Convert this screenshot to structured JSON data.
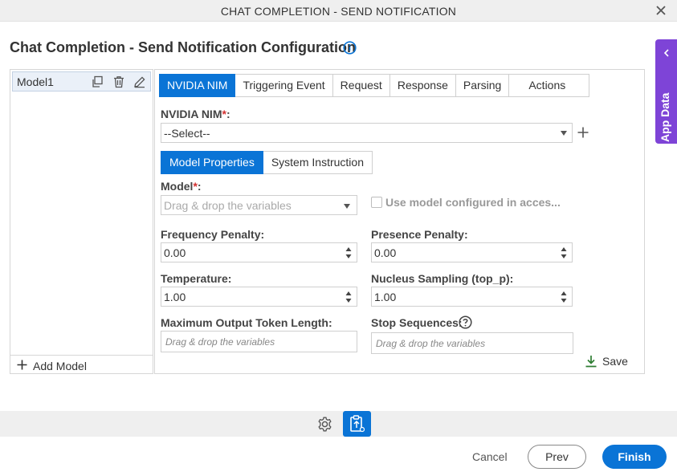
{
  "window": {
    "title": "CHAT COMPLETION - SEND NOTIFICATION"
  },
  "heading": "Chat Completion - Send Notification Configuration",
  "app_data": {
    "label": "App Data"
  },
  "models": {
    "items": [
      "Model1"
    ],
    "add_label": "Add Model"
  },
  "tabs": [
    "NVIDIA NIM",
    "Triggering Event",
    "Request",
    "Response",
    "Parsing",
    "Actions"
  ],
  "nim": {
    "label": "NVIDIA NIM",
    "required": "*",
    "colon": ":",
    "value": "--Select--"
  },
  "subtabs": [
    "Model Properties",
    "System Instruction"
  ],
  "model": {
    "label": "Model",
    "required": "*",
    "colon": ":",
    "placeholder": "Drag & drop the variables",
    "checkbox_label": "Use model configured in acces..."
  },
  "fields": {
    "frequency_penalty": {
      "label": "Frequency Penalty:",
      "value": "0.00"
    },
    "presence_penalty": {
      "label": "Presence Penalty:",
      "value": "0.00"
    },
    "temperature": {
      "label": "Temperature:",
      "value": "1.00"
    },
    "top_p": {
      "label": "Nucleus Sampling (top_p):",
      "value": "1.00"
    },
    "max_tokens": {
      "label": "Maximum Output Token Length:",
      "placeholder": "Drag & drop the variables"
    },
    "stop_sequences": {
      "label": "Stop Sequences:",
      "placeholder": "Drag & drop the variables"
    }
  },
  "save_label": "Save",
  "footer": {
    "cancel": "Cancel",
    "prev": "Prev",
    "finish": "Finish"
  },
  "colors": {
    "accent": "#0a74d6",
    "app_data": "#7e44d7",
    "required": "#d32f2f",
    "save_icon": "#2e7d32"
  }
}
